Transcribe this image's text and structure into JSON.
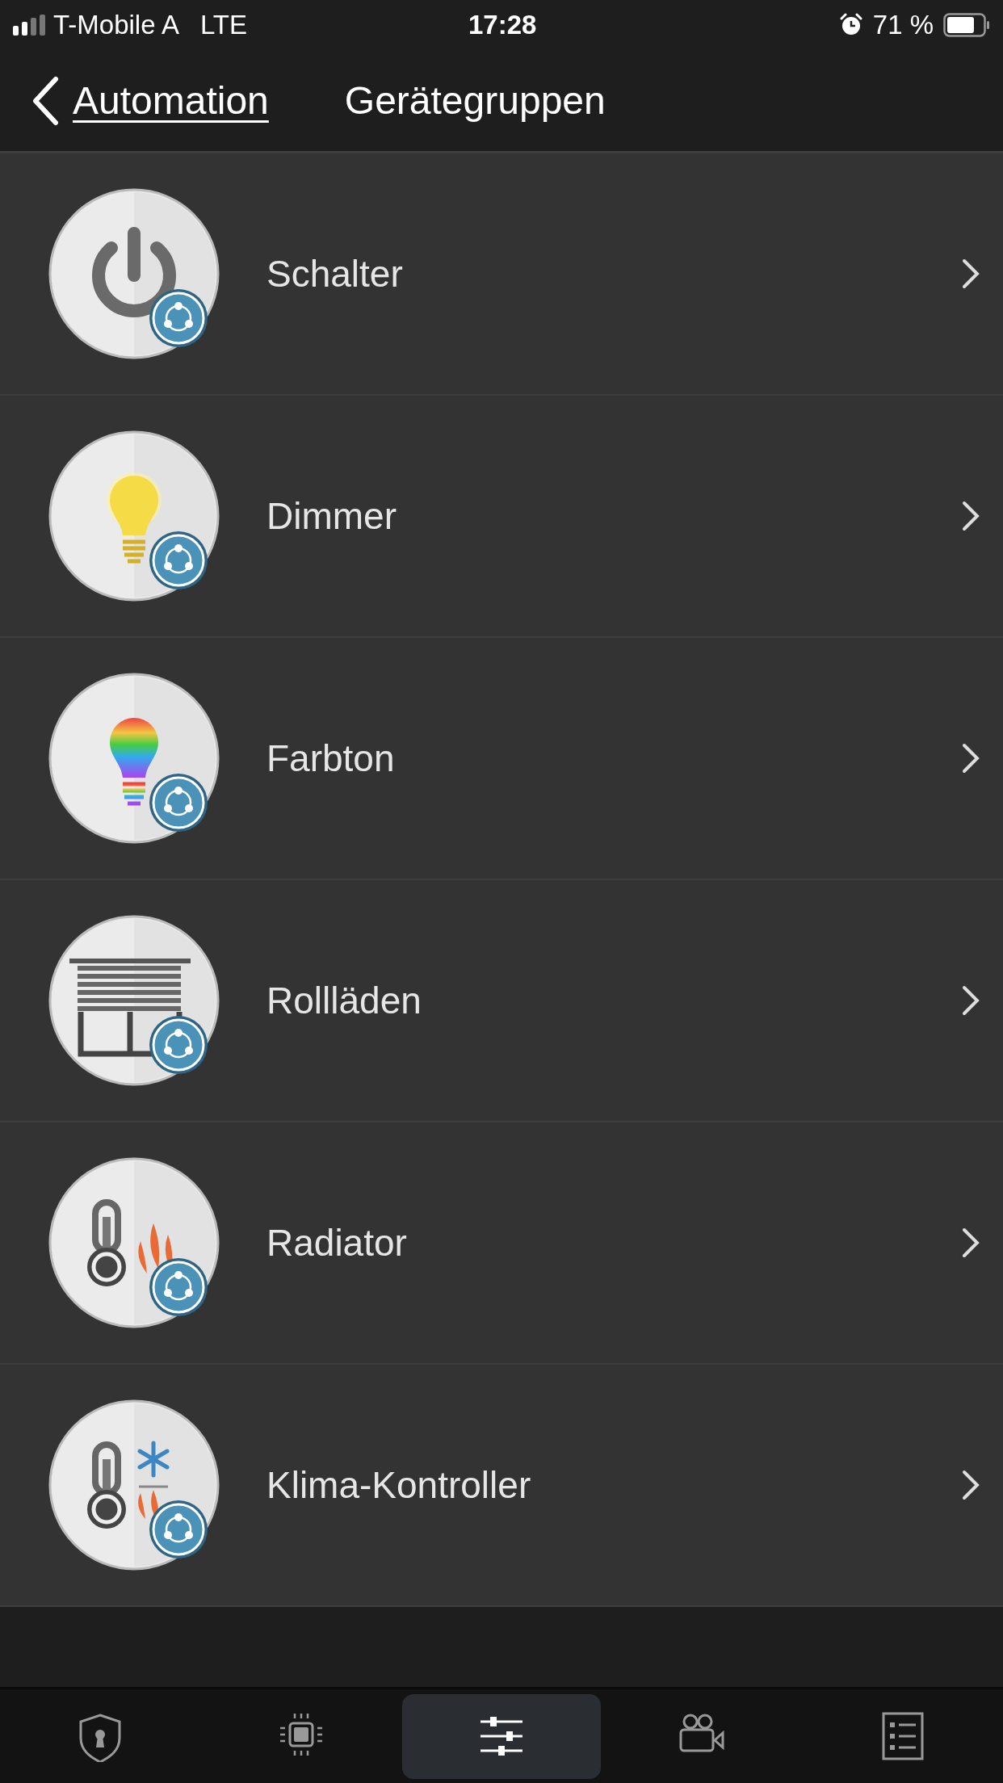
{
  "status_bar": {
    "carrier": "T-Mobile A",
    "network": "LTE",
    "time": "17:28",
    "battery": "71 %"
  },
  "nav": {
    "back": "Automation",
    "title": "Gerätegruppen"
  },
  "rows": [
    {
      "label": "Schalter",
      "kind": "power"
    },
    {
      "label": "Dimmer",
      "kind": "bulb"
    },
    {
      "label": "Farbton",
      "kind": "color-bulb"
    },
    {
      "label": "Rollläden",
      "kind": "blinds"
    },
    {
      "label": "Radiator",
      "kind": "radiator"
    },
    {
      "label": "Klima-Kontroller",
      "kind": "climate"
    }
  ],
  "tabs": [
    {
      "kind": "security",
      "selected": false
    },
    {
      "kind": "devices",
      "selected": false
    },
    {
      "kind": "automation",
      "selected": true
    },
    {
      "kind": "cameras",
      "selected": false
    },
    {
      "kind": "log",
      "selected": false
    }
  ]
}
